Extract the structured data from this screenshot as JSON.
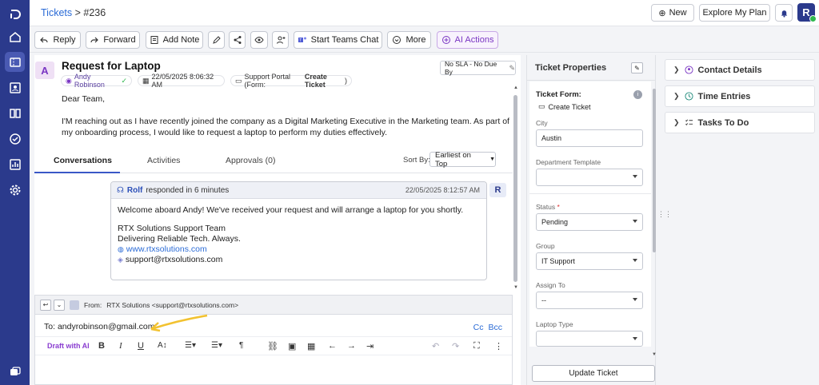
{
  "breadcrumb": {
    "section": "Tickets",
    "separator": ">",
    "ticket_id": "#236"
  },
  "topbar": {
    "new_label": "New",
    "plan_label": "Explore My Plan",
    "user_initial": "R"
  },
  "toolbar": {
    "reply": "Reply",
    "forward": "Forward",
    "add_note": "Add Note",
    "teams_chat": "Start Teams Chat",
    "more": "More",
    "ai_actions": "AI Actions"
  },
  "ticket": {
    "avatar_initial": "A",
    "title": "Request for Laptop",
    "requester": "Andy Robinson",
    "created": "22/05/2025 8:06:32 AM",
    "source_prefix": "Support Portal (Form:",
    "source_form": "Create Ticket",
    "source_suffix": ")",
    "sla": "No SLA - No Due By",
    "greeting": "Dear Team,",
    "body": "I'M reaching out as I have recently joined the company as a Digital Marketing Executive in the Marketing team. As part of my onboarding process, I would like to request a laptop to perform my duties effectively."
  },
  "tabs": {
    "conversations": "Conversations",
    "activities": "Activities",
    "approvals": "Approvals (0)"
  },
  "sort": {
    "label": "Sort By:",
    "value": "Earliest on Top"
  },
  "reply_card": {
    "author": "Rolf",
    "action": "responded in 6 minutes",
    "time": "22/05/2025 8:12:57 AM",
    "avatar_initial": "R",
    "message": "Welcome aboard Andy! We've received your request and will arrange a laptop for you shortly.",
    "sig_company": "RTX Solutions Support Team",
    "sig_tagline": "Delivering Reliable Tech. Always.",
    "sig_web": "www.rtxsolutions.com",
    "sig_email": "support@rtxsolutions.com"
  },
  "composer": {
    "from_label": "From:",
    "from_value": "RTX Solutions <support@rtxsolutions.com>",
    "to_label": "To:",
    "to_value": "andyrobinson@gmail.com",
    "cc": "Cc",
    "bcc": "Bcc",
    "draft_ai": "Draft with AI"
  },
  "properties": {
    "title": "Ticket Properties",
    "form_label": "Ticket Form:",
    "form_value": "Create Ticket",
    "city_label": "City",
    "city_value": "Austin",
    "dept_label": "Department Template",
    "dept_value": "",
    "status_label": "Status",
    "status_required": "*",
    "status_value": "Pending",
    "group_label": "Group",
    "group_value": "IT Support",
    "assign_label": "Assign To",
    "assign_value": "--",
    "laptop_label": "Laptop Type",
    "laptop_value": "",
    "update_button": "Update Ticket"
  },
  "accordion": {
    "contact": "Contact Details",
    "time": "Time Entries",
    "tasks": "Tasks To Do"
  },
  "colors": {
    "nav": "#2b3a8c",
    "link": "#2b6bd6",
    "ai": "#8a3dd0",
    "arrow": "#f2c230"
  }
}
